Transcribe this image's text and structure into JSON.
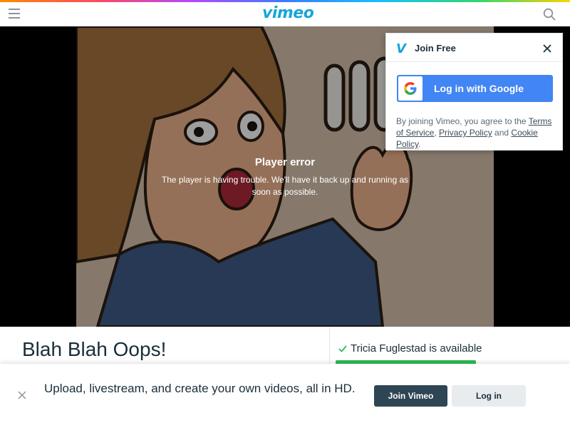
{
  "header": {
    "logo_text": "vimeo",
    "menu_icon": "hamburger-menu-icon",
    "search_icon": "search-icon"
  },
  "player": {
    "error_title": "Player error",
    "error_message": "The player is having trouble. We'll have it back up and running as soon as possible."
  },
  "join_popup": {
    "title": "Join Free",
    "google_button_label": "Log in with Google",
    "legal_prefix": "By joining Vimeo, you agree to the ",
    "terms_link": "Terms of Service",
    "separator_1": ", ",
    "privacy_link": "Privacy Policy",
    "separator_2": " and ",
    "cookie_link": "Cookie Policy",
    "legal_suffix": "."
  },
  "video": {
    "title": "Blah Blah Oops!",
    "availability_text": "Tricia Fuglestad is available"
  },
  "banner": {
    "text": "Upload, livestream, and create your own videos, all in HD.",
    "join_label": "Join Vimeo",
    "login_label": "Log in"
  },
  "colors": {
    "brand": "#17a5d9",
    "google_blue": "#4285f4",
    "dark_button": "#2e4553",
    "available_green": "#2dba55"
  }
}
